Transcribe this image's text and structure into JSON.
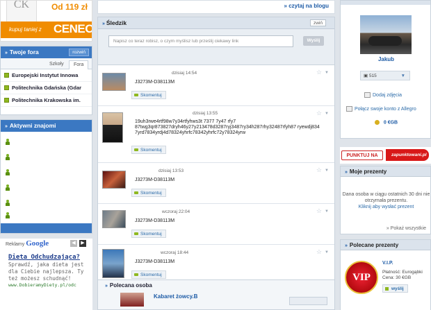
{
  "ceneo_ad": {
    "brand_logo": "CK",
    "price": "Od 119 zł",
    "buy_text": "kupuj taniej z",
    "brand": "CENEO"
  },
  "fora": {
    "title": "Twoje fora",
    "select": "rozwiń",
    "tabs": [
      "Szkoły",
      "Fora"
    ],
    "items": [
      "Europejski Instytut Innowa",
      "Politechnika Gdańska (Gdar",
      "Politechnika Krakowska im."
    ]
  },
  "friends": {
    "title": "Aktywni znajomi",
    "count_visible": 6
  },
  "google_ads": {
    "reklamy": "Reklamy",
    "google": "Google",
    "title": "Dieta Odchudzająca?",
    "text": "Sprawdź, jaka dieta jest dla Ciebie najlepsza. Ty też możesz schudnąć!",
    "url": "www.DobieramyDiety.pl/odc"
  },
  "blog_link": "» czytaj na blogu",
  "sledzik": {
    "title": "Śledzik",
    "collapse": "zwiń",
    "placeholder": "Napisz co teraz robisz, o czym myślisz lub prześlij ciekawy link",
    "send": "Wyślij",
    "comment_label": "Skomentuj",
    "entries": [
      {
        "time": "dzisiaj 14:54",
        "text": "J3273M-D38113M"
      },
      {
        "time": "dzisiaj 13:55",
        "text": "19uh3rwe4rtf98w7y34rtfyhws3t 7377 7y47 rfy7 87twg3qr873827dryh46y27y213478d3287ryj3487ry34h287rhy32487rfyh87 ryewdj834 7yrd7834yrdj4d78324yhrfc78342yhrfc72y78324yrw"
      },
      {
        "time": "dzisiaj 13:53",
        "text": "J3273M-D38113M"
      },
      {
        "time": "wczoraj 22:04",
        "text": "J3273M-D38113M"
      },
      {
        "time": "wczoraj 18:44",
        "text": "J3273M-D38113M"
      }
    ]
  },
  "polecana": {
    "title": "Polecana osoba",
    "name": "Kabaret żowcy.B"
  },
  "profile": {
    "name": "Jakub",
    "points": "515",
    "add_photos": "Dodaj zdjęcia",
    "allegro": "Połącz swoje konto z Allegro",
    "egb": "0 €GB"
  },
  "punkty": {
    "label": "PUNKTUJ NA",
    "site": "zapunktowani.pl"
  },
  "prezenty": {
    "title": "Moje prezenty",
    "text": "Dana osoba w ciągu ostatnich 30 dni nie otrzymała prezentu.",
    "link": "Kliknij aby wysłać prezent",
    "show_all": "» Pokaż wszystkie"
  },
  "polecane_prezenty": {
    "title": "Polecane prezenty",
    "badge": "VIP",
    "name": "V.I.P.",
    "payment": "Płatność: Eurogąbki",
    "price": "Cena: 30 €GB",
    "send": "wyślij"
  }
}
